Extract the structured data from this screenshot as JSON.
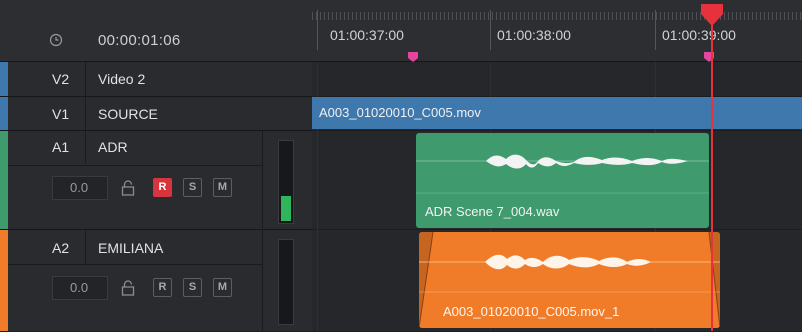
{
  "header": {
    "timecode": "00:00:01:06",
    "icon": "clock-icon"
  },
  "ruler": {
    "labels": [
      "01:00:37:00",
      "01:00:38:00",
      "01:00:39:00"
    ],
    "marker_color": "#e5459e"
  },
  "tracks": {
    "v2": {
      "id": "V2",
      "name": "Video 2"
    },
    "v1": {
      "id": "V1",
      "name": "SOURCE"
    },
    "a1": {
      "id": "A1",
      "name": "ADR",
      "volume": "0.0",
      "buttons": [
        "R",
        "S",
        "M"
      ],
      "record_armed": true,
      "meter_level": 0.3
    },
    "a2": {
      "id": "A2",
      "name": "EMILIANA",
      "volume": "0.0",
      "buttons": [
        "R",
        "S",
        "M"
      ],
      "record_armed": false,
      "meter_level": 0.0
    }
  },
  "clips": {
    "v1": "A003_01020010_C005.mov",
    "a1": "ADR Scene 7_004.wav",
    "a2": "A003_01020010_C005.mov_1"
  },
  "colors": {
    "video_track": "#3e78ad",
    "audio_a1": "#3f9a6e",
    "audio_a2": "#f07c2a",
    "playhead": "#e5323d",
    "record_button": "#d8343e"
  }
}
